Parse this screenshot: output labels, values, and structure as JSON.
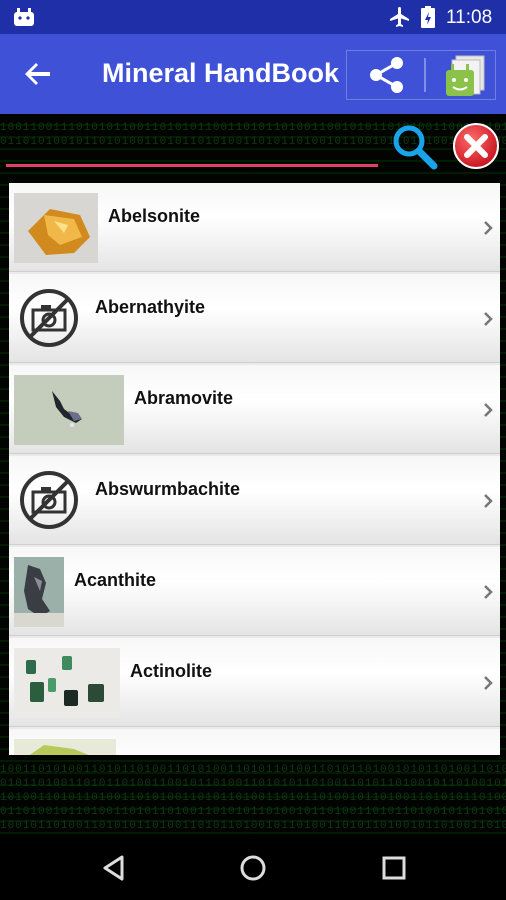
{
  "status_bar": {
    "time": "11:08"
  },
  "app_bar": {
    "title": "Mineral HandBook"
  },
  "search": {
    "value": "",
    "placeholder": ""
  },
  "minerals": [
    {
      "name": "Abelsonite",
      "thumb": "amber-crystal"
    },
    {
      "name": "Abernathyite",
      "thumb": "no-photo"
    },
    {
      "name": "Abramovite",
      "thumb": "dark-crystal"
    },
    {
      "name": "Abswurmbachite",
      "thumb": "no-photo"
    },
    {
      "name": "Acanthite",
      "thumb": "grey-crystal"
    },
    {
      "name": "Actinolite",
      "thumb": "green-crystals"
    },
    {
      "name": "",
      "thumb": "yellow-green-crystal"
    }
  ],
  "colors": {
    "status_bar": "#1f2fa7",
    "app_bar": "#3f51d6",
    "accent_underline": "#e0406a",
    "search_icon": "#1aa3e8",
    "clear_icon": "#e0202a"
  },
  "matrix_rows": [
    "1001100111010101100110101011001101011010011001010110101001100110101",
    "0110101001011010100110101101010011010110100101100101101010011010100",
    "1001101010011010110100110101001101011010011010110100101011010011010",
    "0101101001101011010011001011010011010101101001101011010010110100101",
    "1010011010110100110101001101011010011010110100101101001101010110100",
    "0110100101101001101011010011010101101001011010011010110100101101010",
    "1001011010011010101101001101011010010110100110101101001011010011010"
  ]
}
